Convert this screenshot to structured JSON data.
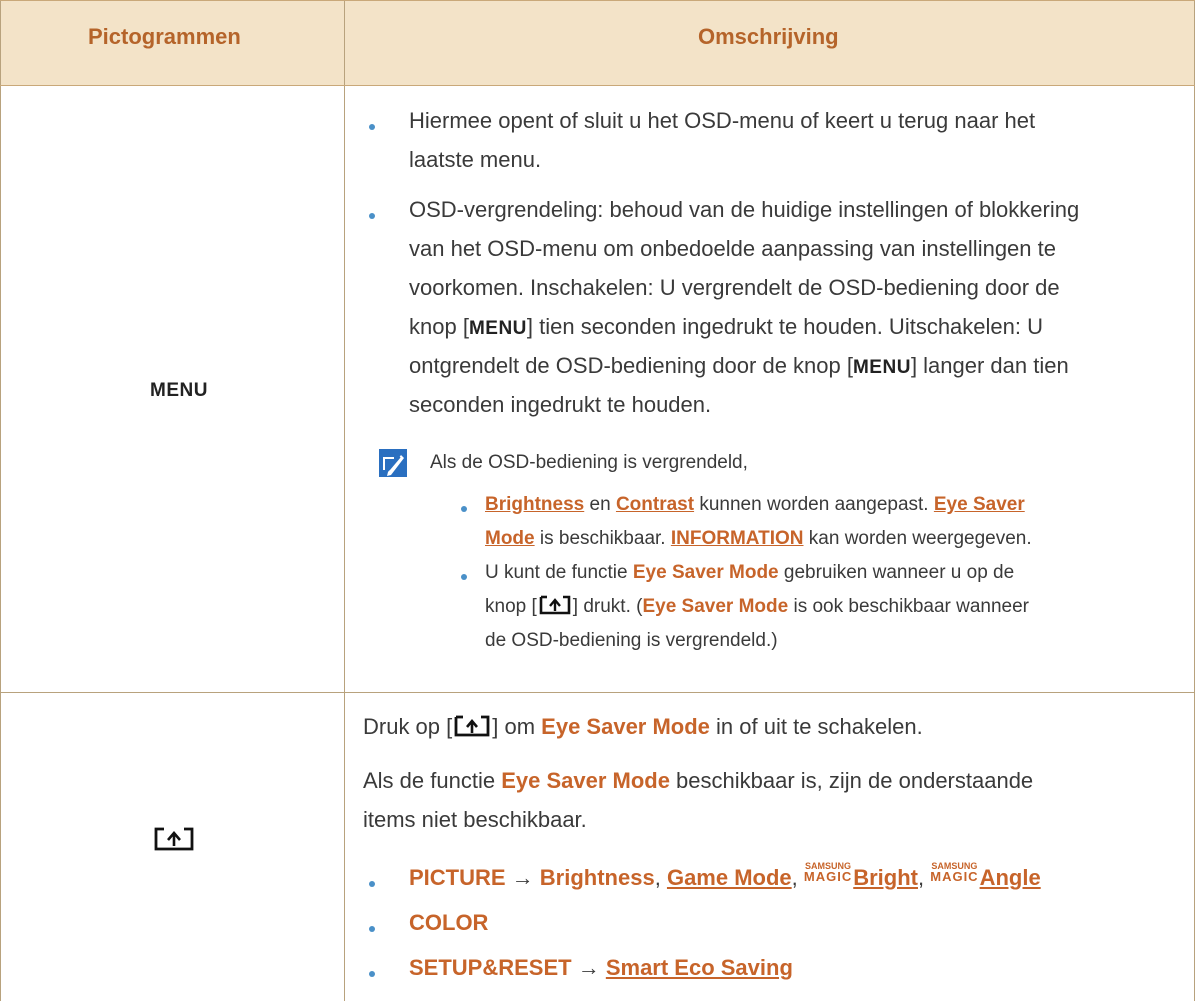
{
  "header": {
    "col1": "Pictogrammen",
    "col2": "Omschrijving"
  },
  "row1": {
    "icon_label": "MENU",
    "bullet1": [
      "Hiermee opent of sluit u het OSD-menu of keert u terug naar het",
      "laatste menu."
    ],
    "bullet2": [
      "OSD-vergrendeling: behoud van de huidige instellingen of blokkering",
      "van het OSD-menu om onbedoelde aanpassing van instellingen te",
      "voorkomen. Inschakelen: U vergrendelt de OSD-bediening door de"
    ],
    "b2_l4_pre": "knop [",
    "b2_menu": "MENU",
    "b2_l4_post": "] tien seconden ingedrukt te houden. Uitschakelen: U",
    "b2_l5_pre": "ontgrendelt de OSD-bediening door de knop [",
    "b2_l5_post": "] langer dan tien",
    "b2_l6": "seconden ingedrukt te houden.",
    "note_intro": "Als de OSD-bediening is vergrendeld,",
    "note_b1": {
      "brightness": "Brightness",
      "en": " en ",
      "contrast": "Contrast",
      "can_adjust": " kunnen worden aangepast. ",
      "eye_saver": "Eye Saver",
      "mode": "Mode",
      "available": " is beschikbaar. ",
      "information": "INFORMATION",
      "shown": " kan worden weergegeven."
    },
    "note_b2": {
      "l1_pre": "U kunt de functie ",
      "eye_saver_mode": "Eye Saver Mode",
      "l1_post": " gebruiken wanneer u op de",
      "l2_pre": "knop [",
      "l2_mid": "] drukt. (",
      "l2_post": " is ook beschikbaar wanneer",
      "l3": "de OSD-bediening is vergrendeld.)"
    }
  },
  "row2": {
    "l1_pre": "Druk op [",
    "l1_mid": "] om ",
    "eye_saver_mode": "Eye Saver Mode",
    "l1_post": " in of uit te schakelen.",
    "l2_pre": "Als de functie ",
    "l2_post": " beschikbaar is, zijn de onderstaande",
    "l3": "items niet beschikbaar.",
    "items": {
      "picture": "PICTURE",
      "arrow": " → ",
      "brightness": "Brightness",
      "comma": ", ",
      "game_mode": "Game Mode",
      "samsung": "SAMSUNG",
      "magic": "MAGIC",
      "bright": "Bright",
      "angle": "Angle",
      "color": "COLOR",
      "setup_reset": "SETUP&RESET",
      "smart_eco": "Smart Eco Saving"
    }
  },
  "colors": {
    "accent": "#c7642a",
    "header_bg": "#f3e3c8",
    "border": "#b8a27d",
    "bullet": "#4a90c8",
    "note_icon": "#2a6fc0"
  },
  "icons": {
    "note": "pencil-note-icon",
    "key": "eye-saver-key-icon"
  }
}
